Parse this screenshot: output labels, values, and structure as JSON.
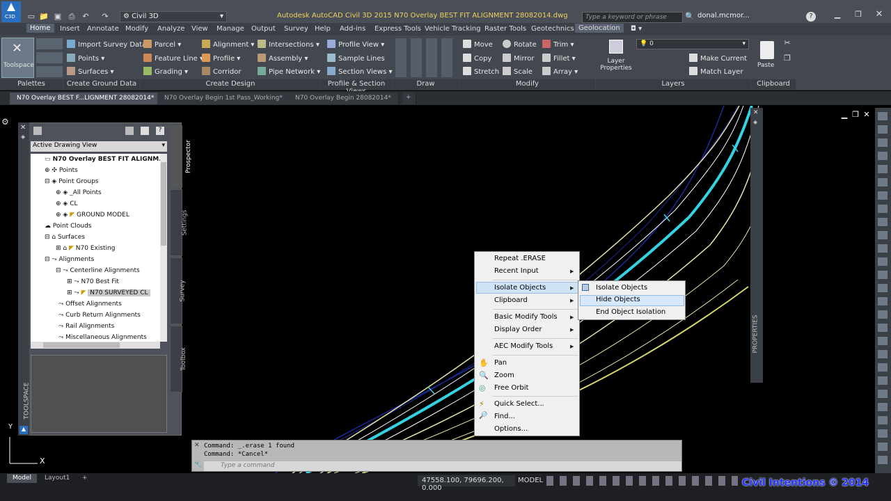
{
  "app": {
    "title": "Autodesk AutoCAD Civil 3D 2015    N70 Overlay BEST FIT ALIGNMENT 28082014.dwg",
    "workspace": "Civil 3D",
    "search_placeholder": "Type a keyword or phrase",
    "user": "donal.mcmor...",
    "logo_text": "C3D"
  },
  "menu": [
    "Home",
    "Insert",
    "Annotate",
    "Modify",
    "Analyze",
    "View",
    "Manage",
    "Output",
    "Survey",
    "Help",
    "Add-ins",
    "Express Tools",
    "Vehicle Tracking",
    "Raster Tools",
    "Geotechnics",
    "Geolocation"
  ],
  "ribbon": {
    "toolspace": "Toolspace",
    "ground": [
      "Import Survey Data",
      "Points",
      "Surfaces"
    ],
    "design": [
      "Parcel",
      "Feature Line",
      "Grading",
      "Alignment",
      "Profile",
      "Corridor",
      "Intersections",
      "Assembly",
      "Pipe Network"
    ],
    "profile": [
      "Profile View",
      "Sample Lines",
      "Section Views"
    ],
    "modify": [
      "Move",
      "Copy",
      "Stretch",
      "Rotate",
      "Mirror",
      "Scale",
      "Trim",
      "Fillet",
      "Array"
    ],
    "layers": [
      "Layer Properties",
      "Make Current",
      "Match Layer"
    ],
    "layer_value": "0",
    "clipboard": "Paste",
    "panels": [
      "Palettes",
      "Create Ground Data",
      "Create Design",
      "Profile & Section Views",
      "Draw",
      "Modify",
      "Layers",
      "Clipboard"
    ]
  },
  "doctabs": [
    "N70 Overlay BEST F...LIGNMENT 28082014*",
    "N70 Overlay Begin 1st Pass_Working*",
    "N70 Overlay Begin 28082014*"
  ],
  "toolspace": {
    "view": "Active Drawing View",
    "tree": [
      "N70 Overlay BEST FIT ALIGNM...",
      "Points",
      "Point Groups",
      "_All Points",
      "CL",
      "GROUND MODEL",
      "Point Clouds",
      "Surfaces",
      "N70 Existing",
      "Alignments",
      "Centerline Alignments",
      "N70 Best Fit",
      "N70 SURVEYED CL",
      "Offset Alignments",
      "Curb Return Alignments",
      "Rail Alignments",
      "Miscellaneous Alignments"
    ],
    "tabs": [
      "Prospector",
      "Settings",
      "Survey",
      "Toolbox"
    ],
    "label": "TOOLSPACE"
  },
  "context_menu": [
    "Repeat .ERASE",
    "Recent Input",
    "Isolate Objects",
    "Clipboard",
    "Basic Modify Tools",
    "Display Order",
    "AEC Modify Tools",
    "Pan",
    "Zoom",
    "Free Orbit",
    "Quick Select...",
    "Find...",
    "Options..."
  ],
  "submenu": [
    "Isolate Objects",
    "Hide Objects",
    "End Object Isolation"
  ],
  "properties_label": "PROPERTIES",
  "command": {
    "lines": [
      "Command:  _.erase 1 found",
      "Command: *Cancel*"
    ],
    "placeholder": "Type a command"
  },
  "status": {
    "tabs": [
      "Model",
      "Layout1"
    ],
    "coords": "47558.100, 79696.200, 0.000",
    "model": "MODEL",
    "brand": "Civil Intentions © 2014"
  },
  "ucs": {
    "y": "Y"
  },
  "colors": {
    "accent": "#2f9bd6",
    "cyan": "#34d3e3",
    "yellow": "#e9e9a0"
  }
}
